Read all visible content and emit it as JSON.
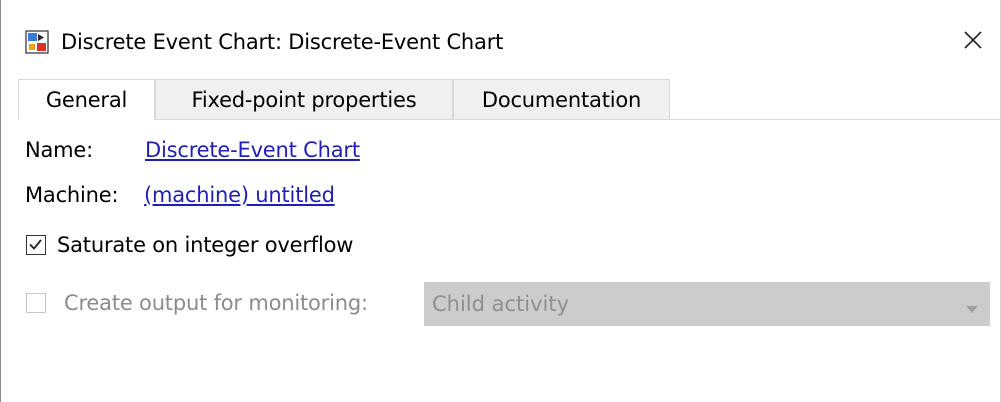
{
  "window": {
    "title": "Discrete Event Chart: Discrete-Event Chart",
    "app_icon": "stateflow-chart-icon",
    "close_icon": "close-icon"
  },
  "tabs": [
    {
      "label": "General",
      "active": true
    },
    {
      "label": "Fixed-point properties",
      "active": false
    },
    {
      "label": "Documentation",
      "active": false
    }
  ],
  "general": {
    "name_label": "Name:",
    "name_value": "Discrete-Event Chart",
    "machine_label": "Machine:",
    "machine_value": "(machine) untitled",
    "saturate_label": "Saturate on integer overflow",
    "saturate_checked": true,
    "monitoring_label": "Create output for monitoring:",
    "monitoring_checked": false,
    "monitoring_enabled": false,
    "monitoring_select_value": "Child activity"
  },
  "colors": {
    "link": "#1f1fb6",
    "disabled_text": "#8c8c8c",
    "disabled_select_bg": "#cccccc"
  }
}
